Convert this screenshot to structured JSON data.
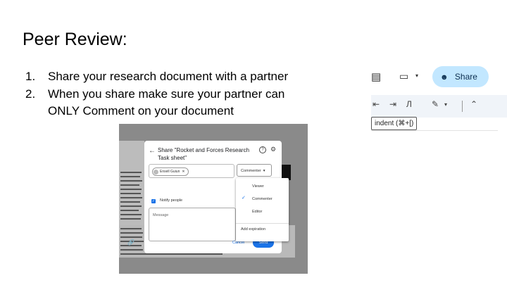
{
  "slide": {
    "title": "Peer Review:",
    "steps": [
      {
        "num": "1.",
        "text": "Share your research document with a partner"
      },
      {
        "num": "2.",
        "text": "When you share make sure your partner can ONLY Comment on your document"
      }
    ]
  },
  "share_dialog": {
    "title": "Share \"Rocket and Forces Research Task sheet\"",
    "chip_name": "Ensell Guiun",
    "role": "Commenter",
    "notify_label": "Notify people",
    "message_placeholder": "Message",
    "cancel_label": "Cancel",
    "send_label": "Send",
    "role_menu": {
      "items": [
        "Viewer",
        "Commenter",
        "Editor"
      ],
      "selected": "Commenter",
      "expiration_label": "Add expiration"
    }
  },
  "toolbar": {
    "share_label": "Share",
    "tooltip": "indent (⌘+[)",
    "icons": [
      "comment-icon",
      "video-icon",
      "share-people-icon",
      "decrease-indent-icon",
      "increase-indent-icon",
      "clear-formatting-icon",
      "pencil-icon",
      "collapse-icon"
    ]
  },
  "colors": {
    "accent": "#1a73e8",
    "share_button_bg": "#c2e7ff",
    "screenshot_bg": "#8a8a8a"
  }
}
